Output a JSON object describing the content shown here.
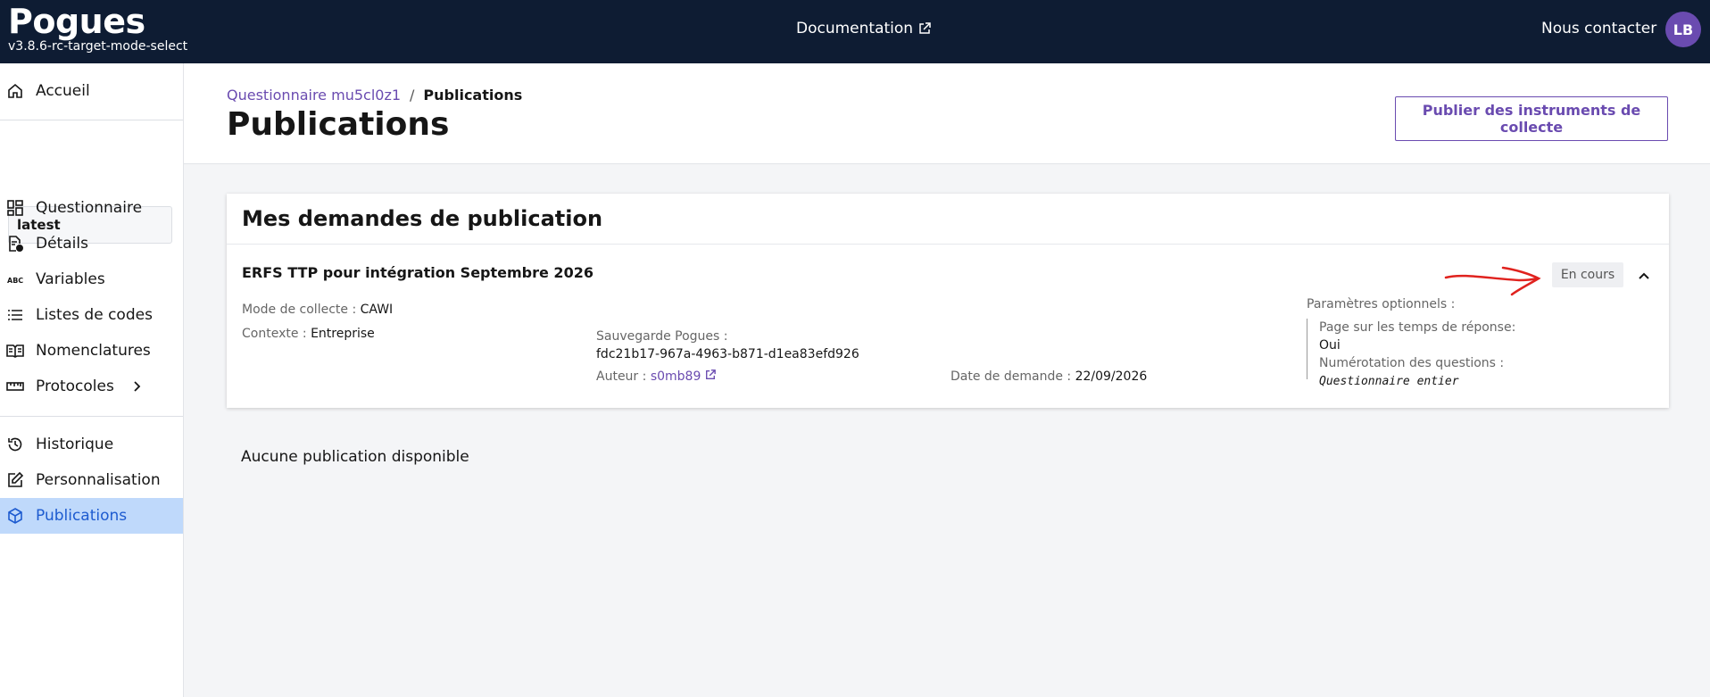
{
  "header": {
    "app_name": "Pogues",
    "version": "v3.8.6-rc-target-mode-select",
    "documentation_label": "Documentation",
    "contact_label": "Nous contacter",
    "avatar_initials": "LB"
  },
  "sidebar": {
    "home_label": "Accueil",
    "version_selector": "latest",
    "items": [
      {
        "label": "Questionnaire",
        "icon": "dashboard-grid-icon"
      },
      {
        "label": "Détails",
        "icon": "document-info-icon"
      },
      {
        "label": "Variables",
        "icon": "abc-icon"
      },
      {
        "label": "Listes de codes",
        "icon": "list-icon"
      },
      {
        "label": "Nomenclatures",
        "icon": "book-icon"
      },
      {
        "label": "Protocoles",
        "icon": "ruler-icon"
      }
    ],
    "secondary": [
      {
        "label": "Historique",
        "icon": "history-icon"
      },
      {
        "label": "Personnalisation",
        "icon": "edit-icon"
      },
      {
        "label": "Publications",
        "icon": "cube-icon"
      }
    ]
  },
  "breadcrumb": {
    "parent": "Questionnaire mu5cl0z1",
    "separator": "/",
    "current": "Publications"
  },
  "page": {
    "title": "Publications",
    "publish_button": "Publier des instruments de collecte"
  },
  "requests": {
    "title": "Mes demandes de publication",
    "item": {
      "name": "ERFS TTP pour intégration Septembre 2026",
      "status": "En cours",
      "mode_label": "Mode de collecte :",
      "mode_value": "CAWI",
      "context_label": "Contexte :",
      "context_value": "Entreprise",
      "backup_label": "Sauvegarde Pogues :",
      "backup_value": "fdc21b17-967a-4963-b871-d1ea83efd926",
      "author_label": "Auteur :",
      "author_value": "s0mb89",
      "date_label": "Date de demande :",
      "date_value": "22/09/2026",
      "optional_label": "Paramètres optionnels :",
      "timing_label": "Page sur les temps de réponse:",
      "timing_value": "Oui",
      "numbering_label": "Numérotation des questions :",
      "numbering_value": "Questionnaire entier"
    }
  },
  "publications": {
    "empty_message": "Aucune publication disponible"
  },
  "colors": {
    "header_bg": "#0e1c33",
    "accent": "#6a4bb0",
    "active_nav_bg": "#bfd9fb",
    "active_nav_text": "#1d5bd0",
    "annotation_red": "#e0221e"
  }
}
